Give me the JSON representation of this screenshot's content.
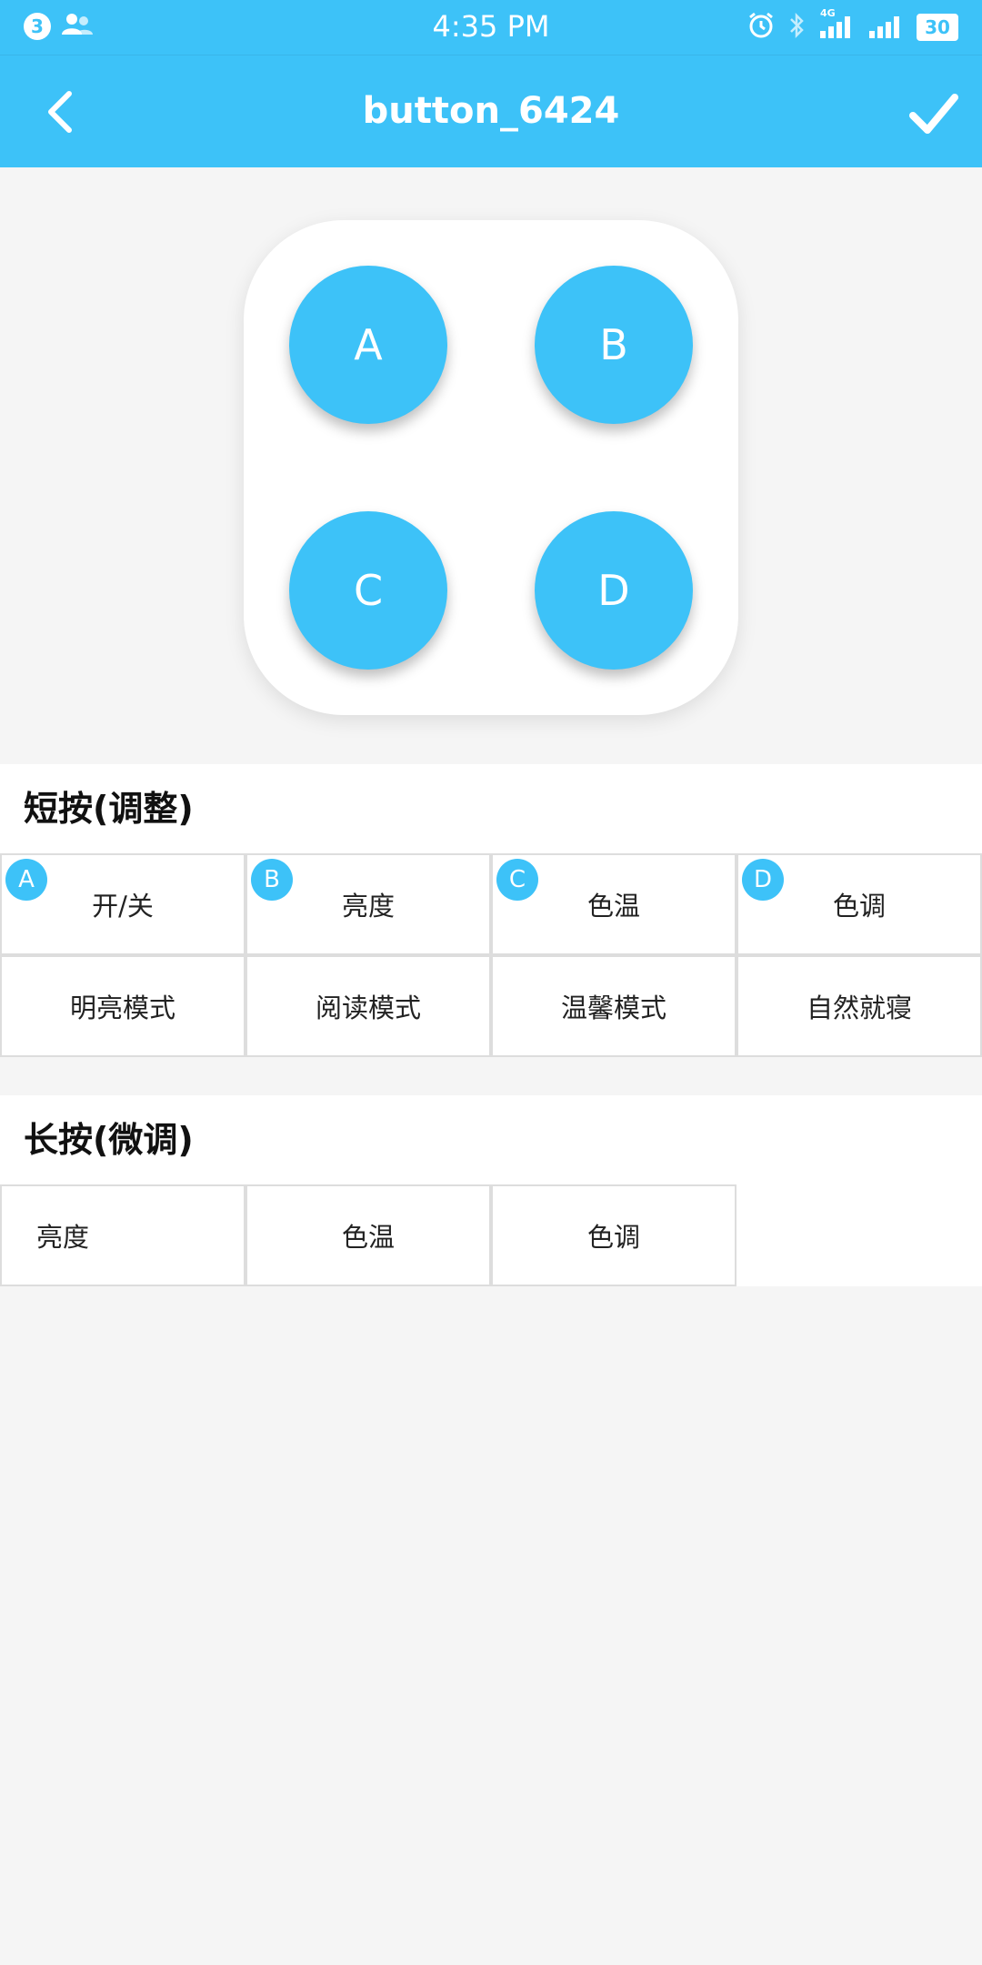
{
  "status_bar": {
    "notification_count": "3",
    "time": "4:35 PM",
    "network": "4G",
    "battery": "30"
  },
  "app_bar": {
    "title": "button_6424"
  },
  "remote": {
    "buttons": [
      "A",
      "B",
      "C",
      "D"
    ]
  },
  "short_press": {
    "title": "短按(调整)",
    "cells": [
      {
        "badge": "A",
        "label": "开/关"
      },
      {
        "badge": "B",
        "label": "亮度"
      },
      {
        "badge": "C",
        "label": "色温"
      },
      {
        "badge": "D",
        "label": "色调"
      },
      {
        "label": "明亮模式"
      },
      {
        "label": "阅读模式"
      },
      {
        "label": "温馨模式"
      },
      {
        "label": "自然就寝"
      }
    ]
  },
  "long_press": {
    "title": "长按(微调)",
    "cells": [
      {
        "label": "亮度"
      },
      {
        "label": "色温"
      },
      {
        "label": "色调"
      }
    ]
  },
  "colors": {
    "accent": "#3dc2f8",
    "background": "#f5f5f5"
  }
}
